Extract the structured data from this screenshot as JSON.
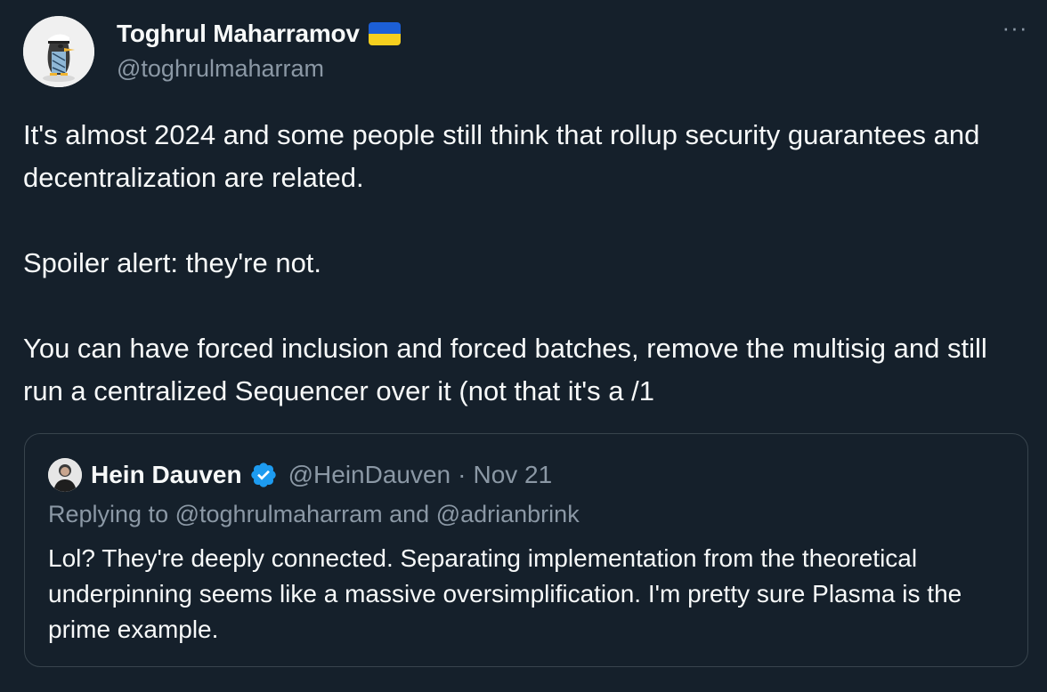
{
  "author": {
    "name": "Toghrul Maharramov",
    "handle": "@toghrulmaharram",
    "flag_icon": "ukraine-flag-icon",
    "avatar_icon": "penguin-avatar"
  },
  "more_label": "···",
  "tweet": {
    "paragraphs": [
      "It's almost 2024 and some people still think that rollup security guarantees and decentralization are related.",
      "Spoiler alert: they're not.",
      "You can have forced inclusion and forced batches, remove the multisig and still run a centralized Sequencer over it (not that it's a /1"
    ]
  },
  "quote": {
    "name": "Hein Dauven",
    "handle": "@HeinDauven",
    "separator": "·",
    "date": "Nov 21",
    "verified_icon": "verified-badge-icon",
    "replying_prefix": "Replying to",
    "mention1": "@toghrulmaharram",
    "and_word": "and",
    "mention2": "@adrianbrink",
    "text": "Lol? They're deeply connected. Separating implementation from the theoretical underpinning seems like a massive oversimplification. I'm pretty sure Plasma is the prime example."
  },
  "colors": {
    "background": "#15202b",
    "text": "#f7f9f9",
    "secondary": "#8b98a5",
    "border": "#38444d",
    "verified": "#1d9bf0"
  }
}
